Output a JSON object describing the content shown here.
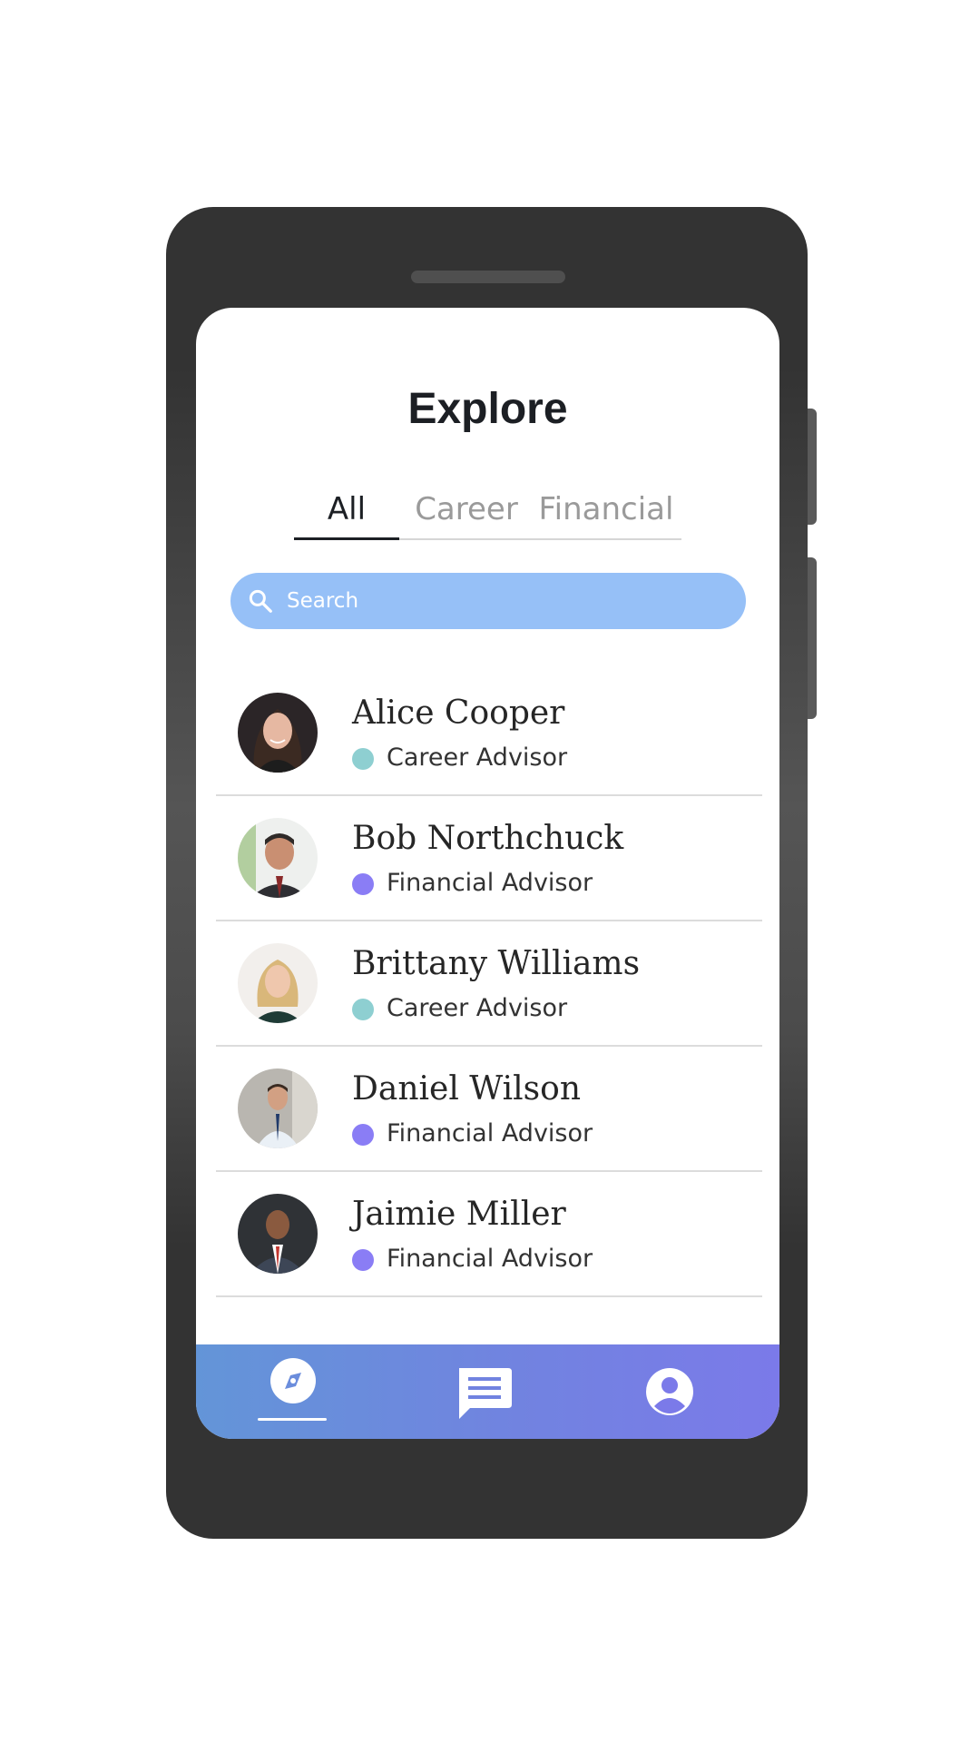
{
  "screen": {
    "title": "Explore"
  },
  "tabs": [
    {
      "label": "All",
      "active": true
    },
    {
      "label": "Career",
      "active": false
    },
    {
      "label": "Financial",
      "active": false
    }
  ],
  "search": {
    "placeholder": "Search",
    "value": ""
  },
  "advisors": [
    {
      "name": "Alice Cooper",
      "role": "Career Advisor",
      "role_color": "#8ecfd1"
    },
    {
      "name": "Bob Northchuck",
      "role": "Financial Advisor",
      "role_color": "#8a7df5"
    },
    {
      "name": "Brittany Williams",
      "role": "Career Advisor",
      "role_color": "#8ecfd1"
    },
    {
      "name": "Daniel Wilson",
      "role": "Financial Advisor",
      "role_color": "#8a7df5"
    },
    {
      "name": "Jaimie Miller",
      "role": "Financial Advisor",
      "role_color": "#8a7df5"
    }
  ],
  "bottom_nav": {
    "items": [
      {
        "icon": "compass-icon",
        "active": true
      },
      {
        "icon": "chat-icon",
        "active": false
      },
      {
        "icon": "account-icon",
        "active": false
      }
    ]
  },
  "colors": {
    "search_bg": "#96c0f7",
    "nav_gradient_start": "#6395d8",
    "nav_gradient_end": "#7b7ae9",
    "phone_body": "#333333"
  }
}
